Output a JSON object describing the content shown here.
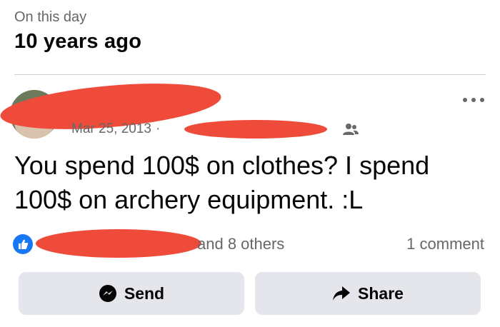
{
  "memory": {
    "label": "On this day",
    "years_ago": "10 years ago"
  },
  "post": {
    "author": "",
    "date": "Mar 25, 2013",
    "separator": "·",
    "audience_icon": "friends-icon",
    "more_icon": "more-horizontal-icon",
    "text": "You spend 100$ on clothes?  I spend 100$ on archery equipment. :L"
  },
  "engagement": {
    "like_icon": "like-icon",
    "names_suffix": "and 8 others",
    "comments": "1 comment"
  },
  "actions": {
    "send_label": "Send",
    "send_icon": "messenger-icon",
    "share_label": "Share",
    "share_icon": "share-arrow-icon"
  },
  "colors": {
    "accent": "#1877f2",
    "redaction": "#ef4b3a",
    "button_bg": "#e4e6eb",
    "muted_text": "#65676b"
  }
}
